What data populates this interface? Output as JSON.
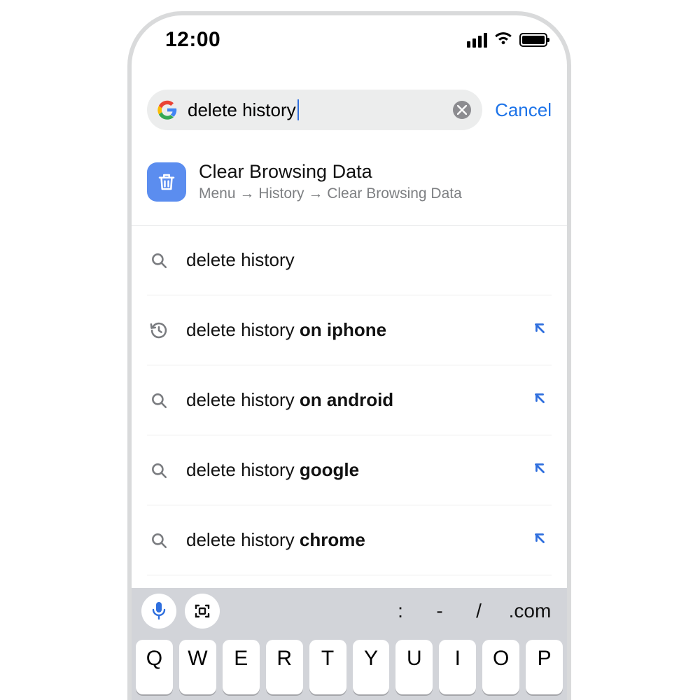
{
  "status": {
    "time": "12:00"
  },
  "search": {
    "query": "delete history",
    "cancel": "Cancel"
  },
  "promo": {
    "title": "Clear Browsing Data",
    "path": "Menu → History → Clear Browsing Data"
  },
  "suggestions": [
    {
      "icon": "search",
      "prefix": "delete history",
      "bold": "",
      "insert": false
    },
    {
      "icon": "history",
      "prefix": "delete history ",
      "bold": "on iphone",
      "insert": true
    },
    {
      "icon": "search",
      "prefix": "delete history ",
      "bold": "on android",
      "insert": true
    },
    {
      "icon": "search",
      "prefix": "delete history ",
      "bold": "google",
      "insert": true
    },
    {
      "icon": "search",
      "prefix": "delete history ",
      "bold": "chrome",
      "insert": true
    }
  ],
  "keyboard": {
    "sym_colon": ":",
    "sym_dash": "-",
    "sym_slash": "/",
    "sym_com": ".com",
    "keys": [
      "Q",
      "W",
      "E",
      "R",
      "T",
      "Y",
      "U",
      "I",
      "O",
      "P"
    ]
  }
}
